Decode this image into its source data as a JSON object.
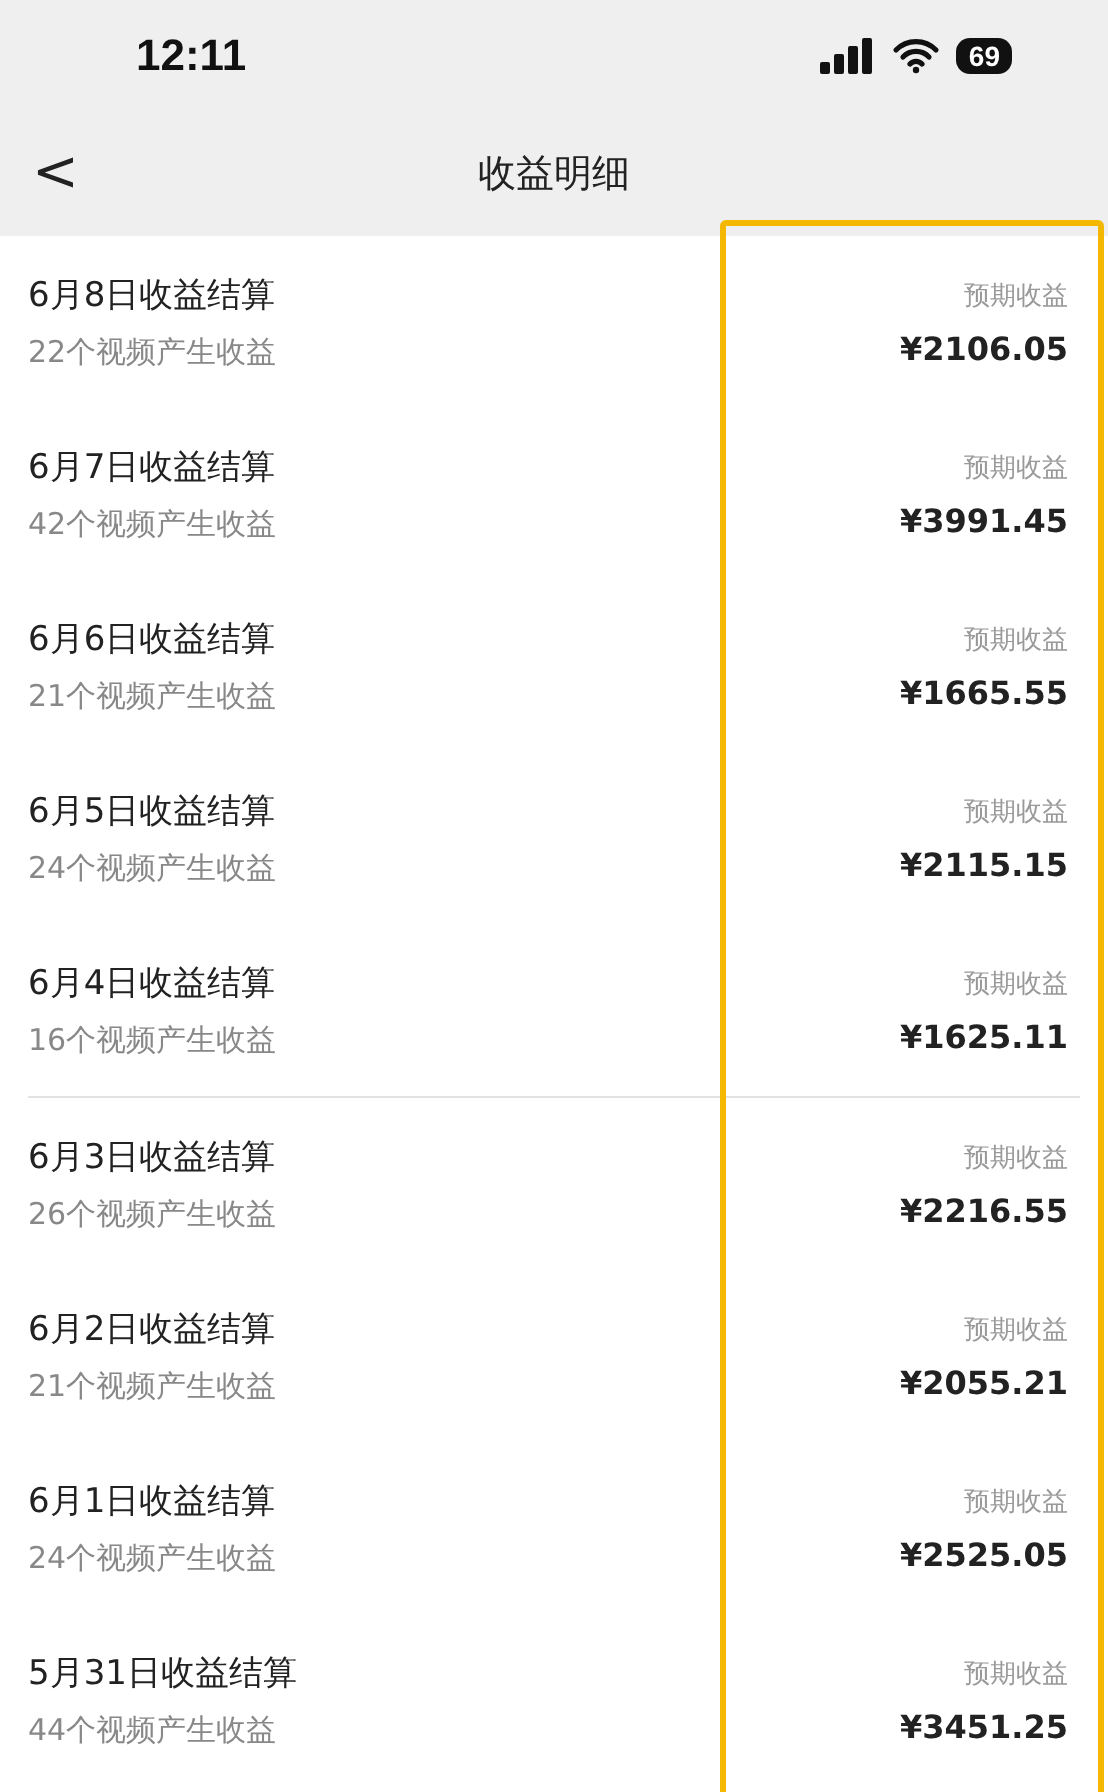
{
  "status_bar": {
    "time": "12:11",
    "battery": "69"
  },
  "nav": {
    "back": "<",
    "title": "收益明细"
  },
  "sections": [
    {
      "rows": [
        {
          "title": "6月8日收益结算",
          "subtitle": "22个视频产生收益",
          "label": "预期收益",
          "amount": "¥2106.05"
        },
        {
          "title": "6月7日收益结算",
          "subtitle": "42个视频产生收益",
          "label": "预期收益",
          "amount": "¥3991.45"
        },
        {
          "title": "6月6日收益结算",
          "subtitle": "21个视频产生收益",
          "label": "预期收益",
          "amount": "¥1665.55"
        },
        {
          "title": "6月5日收益结算",
          "subtitle": "24个视频产生收益",
          "label": "预期收益",
          "amount": "¥2115.15"
        },
        {
          "title": "6月4日收益结算",
          "subtitle": "16个视频产生收益",
          "label": "预期收益",
          "amount": "¥1625.11"
        }
      ]
    },
    {
      "rows": [
        {
          "title": "6月3日收益结算",
          "subtitle": "26个视频产生收益",
          "label": "预期收益",
          "amount": "¥2216.55"
        },
        {
          "title": "6月2日收益结算",
          "subtitle": "21个视频产生收益",
          "label": "预期收益",
          "amount": "¥2055.21"
        },
        {
          "title": "6月1日收益结算",
          "subtitle": "24个视频产生收益",
          "label": "预期收益",
          "amount": "¥2525.05"
        },
        {
          "title": "5月31日收益结算",
          "subtitle": "44个视频产生收益",
          "label": "预期收益",
          "amount": "¥3451.25"
        }
      ]
    }
  ]
}
